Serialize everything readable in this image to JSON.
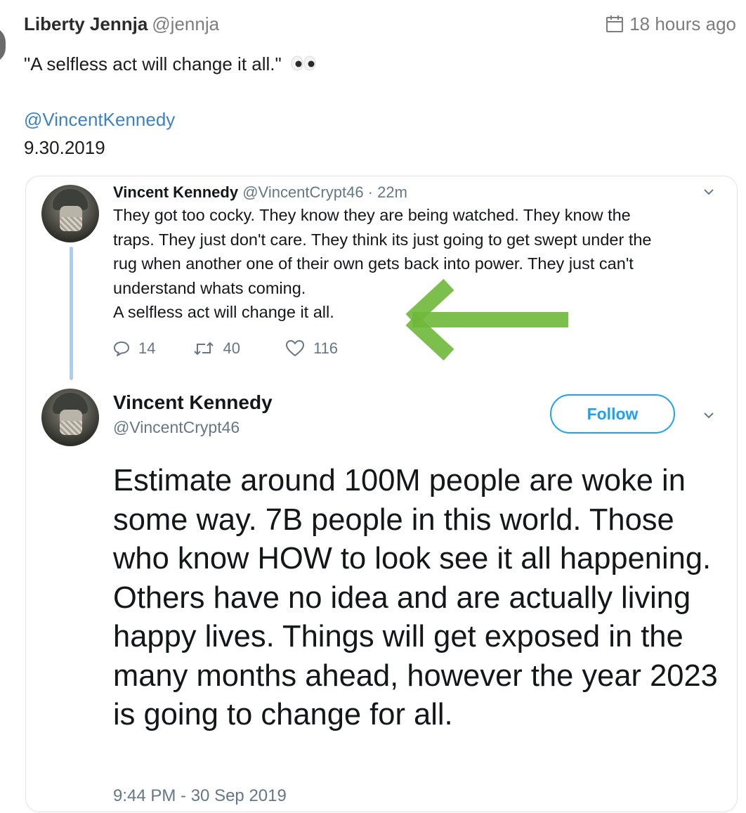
{
  "post": {
    "author": "Liberty Jennja",
    "handle": "@jennja",
    "time": "18 hours ago",
    "text": "\"A selfless act will change it all.\"",
    "mention": "@VincentKennedy",
    "date": "9.30.2019"
  },
  "embed": {
    "tweet1": {
      "name": "Vincent Kennedy",
      "meta": "@VincentCrypt46 · 22m",
      "lines": [
        "They got too cocky. They know they are being watched. They know the",
        "traps. They just don't care. They think its just going to get swept under the",
        "rug when another one of their own gets back into power. They just can't",
        "understand whats coming.",
        "A selfless act will change it all."
      ],
      "replies": "14",
      "retweets": "40",
      "likes": "116"
    },
    "tweet2": {
      "name": "Vincent Kennedy",
      "handle": "@VincentCrypt46",
      "follow_label": "Follow",
      "text": "Estimate around 100M people are woke in some way. 7B people in this world. Those who know HOW to look see it all happening. Others have no idea and are actually living happy lives. Things will get exposed in the many months ahead, however the year 2023 is going to change for all.",
      "timestamp": "9:44 PM - 30 Sep 2019"
    }
  },
  "colors": {
    "link": "#3b82c4",
    "twitter_blue": "#1da1f2",
    "arrow": "#6fb83a",
    "thread_line": "#a9cef2"
  },
  "icons": [
    "calendar-icon",
    "eyes-emoji-icon",
    "chevron-down-icon",
    "reply-icon",
    "retweet-icon",
    "like-icon",
    "green-arrow-annotation"
  ]
}
